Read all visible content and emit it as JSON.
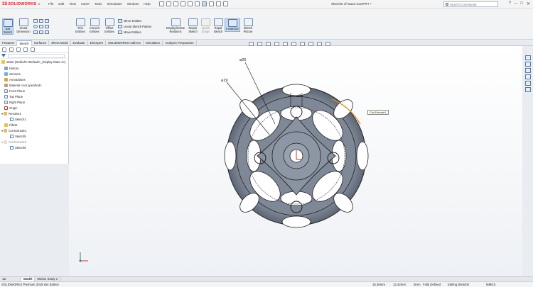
{
  "app": {
    "brand_prefix": "3S",
    "brand_name": "SOLIDWORKS",
    "document_title": "Sketch6 of stator.SLDPRT *",
    "menu": [
      "File",
      "Edit",
      "View",
      "Insert",
      "Tools",
      "Simulation",
      "Window",
      "Help"
    ],
    "search_placeholder": "Search Commands",
    "window_controls": [
      "?",
      "–",
      "□",
      "✕"
    ]
  },
  "ribbon": {
    "exit_sketch": "Exit\nSketch",
    "smart_dimension": "Smart\nDimension",
    "trim_entities": "Trim\nEntities",
    "convert_entities": "Convert\nEntities",
    "offset_entities": "Offset\nEntities",
    "mirror_entities": "Mirror Entities",
    "linear_pattern": "Linear Sketch Pattern",
    "move_entities": "Move Entities",
    "display_delete_relations": "Display/Delete\nRelations",
    "repair_sketch": "Repair\nSketch",
    "quick_snaps": "Quick\nSnaps",
    "rapid_sketch": "Rapid\nSketch",
    "instant2d": "Instant2D",
    "sketch_picture": "Sketch\nPicture"
  },
  "command_tabs": [
    "Features",
    "Sketch",
    "Surfaces",
    "Sheet Metal",
    "Evaluate",
    "DimXpert",
    "SOLIDWORKS Add-Ins",
    "Simulation",
    "Analysis Preparation"
  ],
  "selected_tab": "Sketch",
  "feature_tree": {
    "root": "stator (Default<<Default>_Display State 1>)",
    "items": [
      {
        "label": "History",
        "icon": "history-icon"
      },
      {
        "label": "Sensors",
        "icon": "sensors-icon"
      },
      {
        "label": "Annotations",
        "icon": "annotations-icon"
      },
      {
        "label": "Material <not specified>",
        "icon": "material-icon"
      },
      {
        "label": "Front Plane",
        "icon": "plane-icon"
      },
      {
        "label": "Top Plane",
        "icon": "plane-icon"
      },
      {
        "label": "Right Plane",
        "icon": "plane-icon"
      },
      {
        "label": "Origin",
        "icon": "origin-icon"
      },
      {
        "label": "Revolve1",
        "icon": "revolve-icon"
      },
      {
        "label": "Sketch1",
        "icon": "sketch-icon"
      },
      {
        "label": "Fillet1",
        "icon": "fillet-icon"
      },
      {
        "label": "Cut-Extrude1",
        "icon": "cut-extrude-icon"
      },
      {
        "label": "Sketch5",
        "icon": "sketch-icon"
      },
      {
        "label": "Cut-Extrude2",
        "icon": "cut-extrude-icon"
      },
      {
        "label": "Sketch6",
        "icon": "sketch-icon"
      }
    ]
  },
  "graphics": {
    "dim_outer": "⌀25",
    "dim_inner": "⌀19",
    "dim_hole": "⌀3",
    "callout": "Cut-Extrude1"
  },
  "bottom_tabs": [
    "",
    "Model",
    "Motion Study 1"
  ],
  "status": {
    "edition": "SOLIDWORKS Premium 2018 x64 Edition",
    "x": "15.36mm",
    "y": "12.42mm",
    "z": "0mm",
    "defined": "Fully Defined",
    "editing": "Editing Sketch6",
    "units": "MMGS"
  },
  "colors": {
    "brand": "#d21f2b",
    "part": "#7a8494",
    "accent": "#3d6fa8"
  }
}
